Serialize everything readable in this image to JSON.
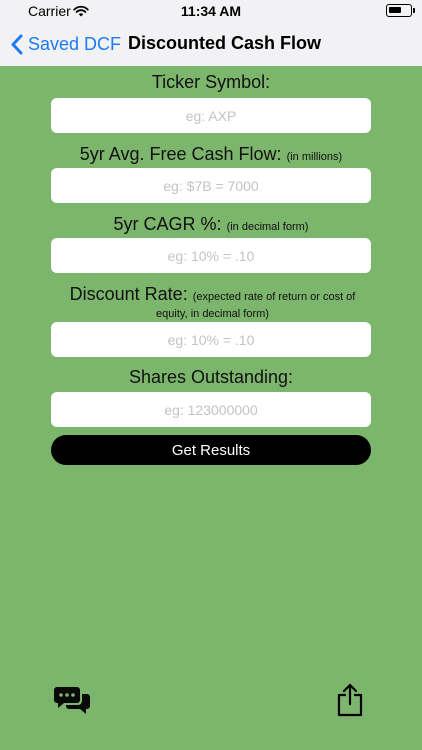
{
  "status_bar": {
    "carrier": "Carrier",
    "time": "11:34 AM"
  },
  "nav": {
    "back_label": "Saved DCF",
    "title": "Discounted Cash Flow"
  },
  "fields": {
    "ticker": {
      "label": "Ticker Symbol:",
      "placeholder": "eg: AXP",
      "value": ""
    },
    "fcf": {
      "label": "5yr Avg. Free Cash Flow:",
      "hint": "(in millions)",
      "placeholder": "eg: $7B = 7000",
      "value": ""
    },
    "cagr": {
      "label": "5yr CAGR %:",
      "hint": "(in decimal form)",
      "placeholder": "eg: 10% = .10",
      "value": ""
    },
    "discount": {
      "label": "Discount Rate:",
      "hint": "(expected rate of return or cost of equity, in decimal form)",
      "placeholder": "eg: 10% = .10",
      "value": ""
    },
    "shares": {
      "label": "Shares Outstanding:",
      "placeholder": "eg: 123000000",
      "value": ""
    }
  },
  "actions": {
    "get_results_label": "Get Results"
  },
  "colors": {
    "background": "#7cb56c",
    "accent": "#1a7cf4",
    "button": "#000000"
  },
  "icons": {
    "chat": "chat-bubbles-icon",
    "share": "share-icon",
    "back": "chevron-left-icon",
    "wifi": "wifi-icon",
    "battery": "battery-icon"
  }
}
